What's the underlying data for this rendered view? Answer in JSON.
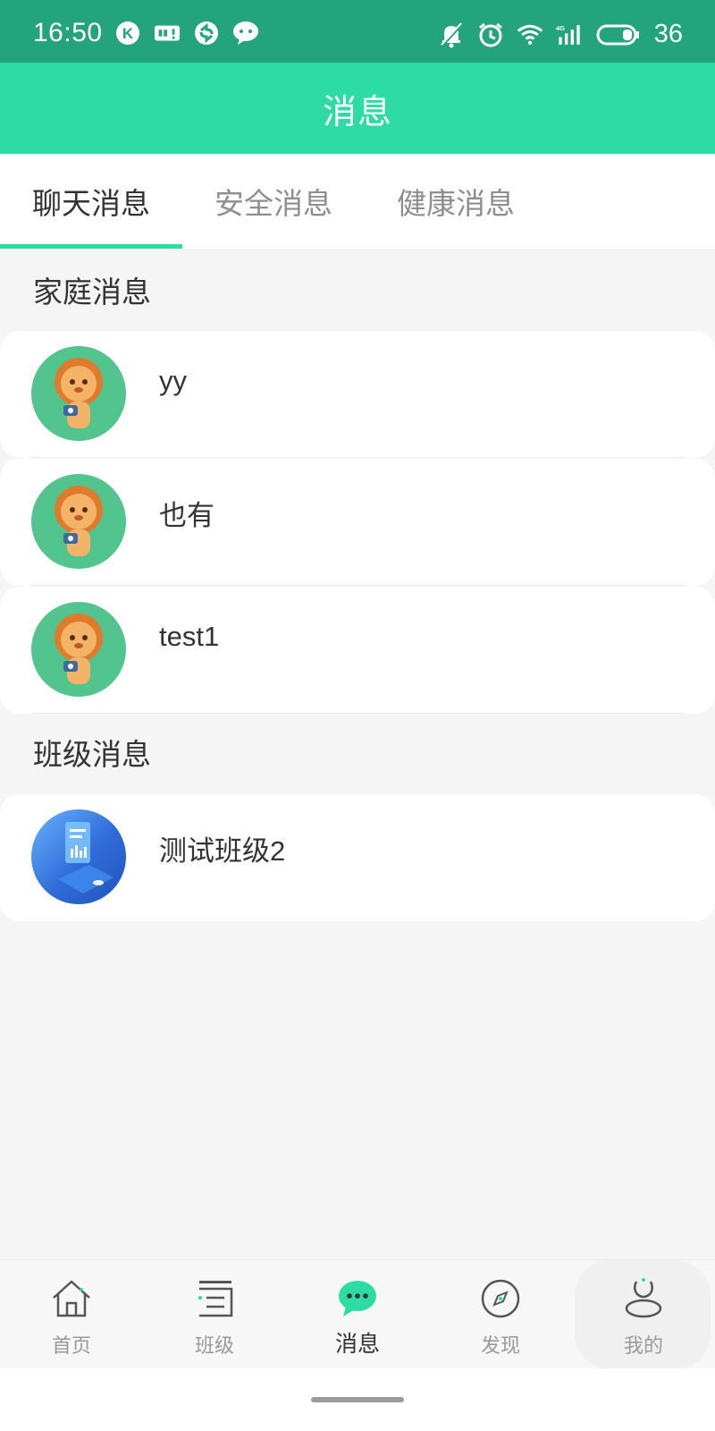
{
  "status_bar": {
    "time": "16:50",
    "battery": "36",
    "left_icons": [
      "k-app-icon",
      "sim-card-icon",
      "sync-icon",
      "chat-bubble-icon"
    ],
    "right_icons": [
      "mute-bell-icon",
      "alarm-icon",
      "wifi-icon",
      "signal-4g-icon",
      "battery-icon"
    ]
  },
  "header": {
    "title": "消息"
  },
  "tabs": [
    {
      "label": "聊天消息",
      "active": true
    },
    {
      "label": "安全消息",
      "active": false
    },
    {
      "label": "健康消息",
      "active": false
    }
  ],
  "sections": {
    "family": {
      "title": "家庭消息",
      "items": [
        {
          "name": "yy",
          "avatar": "lion-avatar-icon"
        },
        {
          "name": "也有",
          "avatar": "lion-avatar-icon"
        },
        {
          "name": "test1",
          "avatar": "lion-avatar-icon"
        }
      ]
    },
    "class": {
      "title": "班级消息",
      "items": [
        {
          "name": "测试班级2",
          "avatar": "class-illustration-icon"
        }
      ]
    }
  },
  "bottom_nav": [
    {
      "label": "首页",
      "icon": "home-icon",
      "active": false
    },
    {
      "label": "班级",
      "icon": "class-icon",
      "active": false
    },
    {
      "label": "消息",
      "icon": "message-icon",
      "active": true
    },
    {
      "label": "发现",
      "icon": "compass-icon",
      "active": false
    },
    {
      "label": "我的",
      "icon": "profile-icon",
      "active": false
    }
  ],
  "colors": {
    "status_bar": "#23a47a",
    "header": "#2ddca2",
    "accent": "#2ddca2",
    "background": "#f5f5f5"
  }
}
